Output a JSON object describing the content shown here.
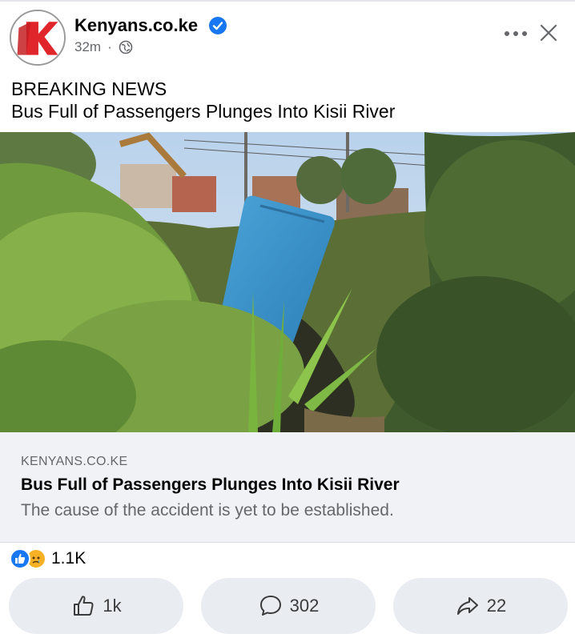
{
  "header": {
    "page_name": "Kenyans.co.ke",
    "time_ago": "32m",
    "separator": "·",
    "avatar_letter": "K",
    "verified_icon": "verified-badge-icon",
    "privacy_icon": "globe-icon",
    "more_icon": "more-options-icon",
    "close_icon": "close-icon"
  },
  "post": {
    "caption_line1": "BREAKING NEWS",
    "caption_line2": "Bus Full of Passengers Plunges Into Kisii River"
  },
  "link_preview": {
    "domain": "KENYANS.CO.KE",
    "title": "Bus Full of Passengers Plunges Into Kisii River",
    "description": "The cause of the accident is yet to be established."
  },
  "reactions": {
    "count": "1.1K",
    "types": [
      "like",
      "sad"
    ]
  },
  "actions": {
    "like_count": "1k",
    "comment_count": "302",
    "share_count": "22"
  },
  "colors": {
    "brand_red": "#e0262b",
    "verified_blue": "#1877f2",
    "muted_text": "#65676b",
    "link_bg": "#f0f2f5",
    "button_bg": "#e9ecf0"
  }
}
